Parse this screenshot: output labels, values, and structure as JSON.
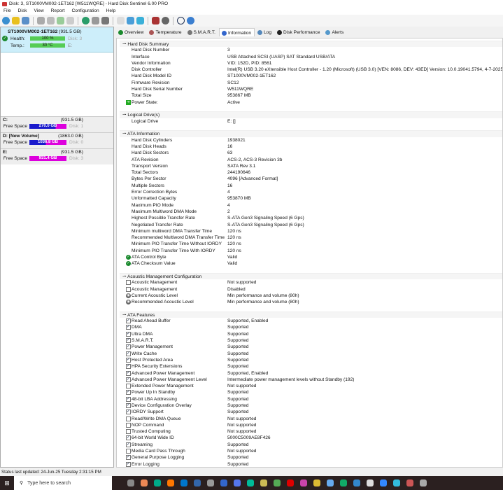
{
  "window": {
    "title": "Disk: 3, ST1000VM002-1ET162 [W511WQRE]  -  Hard Disk Sentinel 6.00 PRO"
  },
  "menu": [
    "File",
    "Disk",
    "View",
    "Report",
    "Configuration",
    "Help"
  ],
  "disk": {
    "name": "ST1000VM002-1ET162",
    "size": "(931.5 GB)",
    "health_label": "Health:",
    "health": "100 %",
    "health_pct": 100,
    "disk_ref": "Disk: 3",
    "temp_label": "Temp.:",
    "temp": "30 °C",
    "drive_ref": "E:"
  },
  "drives": [
    {
      "letter": "C:",
      "size": "(931.5 GB)",
      "free_label": "Free Space",
      "free": "270.0 GB",
      "free_pct": 29,
      "disk": "Disk: 1"
    },
    {
      "letter": "D: [New Volume]",
      "size": "(1863.0 GB)",
      "free_label": "Free Space",
      "free": "1036.8 GB",
      "free_pct": 56,
      "disk": "Disk: 0"
    },
    {
      "letter": "E:",
      "size": "(931.5 GB)",
      "free_label": "Free Space",
      "free": "931.4 GB",
      "free_pct": 100,
      "disk": "Disk: 3"
    }
  ],
  "tabs": [
    {
      "label": "Overview",
      "color": "#1b8a2e"
    },
    {
      "label": "Temperature",
      "color": "#a55"
    },
    {
      "label": "S.M.A.R.T.",
      "color": "#777"
    },
    {
      "label": "Information",
      "color": "#36c",
      "active": true
    },
    {
      "label": "Log",
      "color": "#58b"
    },
    {
      "label": "Disk Performance",
      "color": "#222"
    },
    {
      "label": "Alerts",
      "color": "#59c"
    }
  ],
  "sections": [
    {
      "title": "Hard Disk Summary",
      "rows": [
        [
          "Hard Disk Number",
          "3",
          ""
        ],
        [
          "Interface",
          "USB Attached SCSI (UASP) SAT Standard USB/ATA",
          ""
        ],
        [
          "Vendor Information",
          "VID: 152D, PID: 8561",
          ""
        ],
        [
          "Disk Controller",
          "Intel(R) USB 3.20 eXtensible Host Controller - 1.20 (Microsoft) (USB 3.0) [VEN: 8086, DEV: 43ED] Version: 10.0.19041.5794, 4-7-2025",
          ""
        ],
        [
          "Hard Disk Model ID",
          "ST1000VM002-1ET162",
          ""
        ],
        [
          "Firmware Revision",
          "SC12",
          ""
        ],
        [
          "Hard Disk Serial Number",
          "W511WQRE",
          ""
        ],
        [
          "Total Size",
          "953867 MB",
          ""
        ],
        [
          "Power State:",
          "Active",
          "power"
        ]
      ]
    },
    {
      "title": "Logical Drive(s)",
      "rows": [
        [
          "Logical Drive",
          "E: []",
          ""
        ]
      ]
    },
    {
      "title": "ATA Information",
      "rows": [
        [
          "Hard Disk Cylinders",
          "1938021",
          ""
        ],
        [
          "Hard Disk Heads",
          "16",
          ""
        ],
        [
          "Hard Disk Sectors",
          "63",
          ""
        ],
        [
          "ATA Revision",
          "ACS-2, ACS-3 Revision 3b",
          ""
        ],
        [
          "Transport Version",
          "SATA Rev 3.1",
          ""
        ],
        [
          "Total Sectors",
          "244190646",
          ""
        ],
        [
          "Bytes Per Sector",
          "4096 [Advanced Format]",
          ""
        ],
        [
          "Multiple Sectors",
          "16",
          ""
        ],
        [
          "Error Correction Bytes",
          "4",
          ""
        ],
        [
          "Unformatted Capacity",
          "953870 MB",
          ""
        ],
        [
          "Maximum PIO Mode",
          "4",
          ""
        ],
        [
          "Maximum Multiword DMA Mode",
          "2",
          ""
        ],
        [
          "Highest Possible Transfer Rate",
          "S-ATA Gen3 Signaling Speed (6 Gps)",
          ""
        ],
        [
          "Negotiated Transfer Rate",
          "S-ATA Gen3 Signaling Speed (6 Gps)",
          ""
        ],
        [
          "Minimum multiword DMA Transfer Time",
          "120 ns",
          ""
        ],
        [
          "Recommended Multiword DMA Transfer Time",
          "120 ns",
          ""
        ],
        [
          "Minimum PIO Transfer Time Without IORDY",
          "120 ns",
          ""
        ],
        [
          "Minimum PIO Transfer Time With IORDY",
          "120 ns",
          ""
        ],
        [
          "ATA Control Byte",
          "Valid",
          "ok"
        ],
        [
          "ATA Checksum Value",
          "Valid",
          "ok"
        ]
      ]
    },
    {
      "title": "Acoustic Management Configuration",
      "rows": [
        [
          "Acoustic Management",
          "Not supported",
          "off"
        ],
        [
          "Acoustic Management",
          "Disabled",
          "off"
        ],
        [
          "Current Acoustic Level",
          "Min performance and volume (80h)",
          "speaker"
        ],
        [
          "Recommended Acoustic Level",
          "Min performance and volume (80h)",
          "speaker"
        ]
      ]
    },
    {
      "title": "ATA Features",
      "rows": [
        [
          "Read Ahead Buffer",
          "Supported, Enabled",
          "on"
        ],
        [
          "DMA",
          "Supported",
          "on"
        ],
        [
          "Ultra DMA",
          "Supported",
          "on"
        ],
        [
          "S.M.A.R.T.",
          "Supported",
          "on"
        ],
        [
          "Power Management",
          "Supported",
          "on"
        ],
        [
          "Write Cache",
          "Supported",
          "on"
        ],
        [
          "Host Protected Area",
          "Supported",
          "on"
        ],
        [
          "HPA Security Extensions",
          "Supported",
          "on"
        ],
        [
          "Advanced Power Management",
          "Supported, Enabled",
          "on"
        ],
        [
          "Advanced Power Management Level",
          "Intermediate power management levels without Standby (192)",
          "on"
        ],
        [
          "Extended Power Management",
          "Not supported",
          "off"
        ],
        [
          "Power Up In Standby",
          "Supported",
          "on"
        ],
        [
          "48-bit LBA Addressing",
          "Supported",
          "on"
        ],
        [
          "Device Configuration Overlay",
          "Supported",
          "on"
        ],
        [
          "IORDY Support",
          "Supported",
          "on"
        ],
        [
          "Read/Write DMA Queue",
          "Not supported",
          "off"
        ],
        [
          "NOP Command",
          "Not supported",
          "off"
        ],
        [
          "Trusted Computing",
          "Not supported",
          "off"
        ],
        [
          "64-bit World Wide ID",
          "5000C5009AE8F426",
          "on"
        ],
        [
          "Streaming",
          "Supported",
          "on"
        ],
        [
          "Media Card Pass Through",
          "Not supported",
          "off"
        ],
        [
          "General Purpose Logging",
          "Supported",
          "on"
        ],
        [
          "Error Logging",
          "Supported",
          "on"
        ]
      ]
    }
  ],
  "status": "Status last updated: 24-Jun-25 Tuesday 2:31:15 PM",
  "taskbar": {
    "search_placeholder": "Type here to search",
    "apps": [
      "#888",
      "#e85",
      "#0a8",
      "#f70",
      "#07c",
      "#36a",
      "#999",
      "#36c",
      "#57e",
      "#0b9",
      "#cb5",
      "#5a5",
      "#d00",
      "#c4a",
      "#db3",
      "#6ae",
      "#1a6",
      "#38c",
      "#ddd",
      "#38f",
      "#3bd",
      "#c55",
      "#aaa"
    ]
  }
}
